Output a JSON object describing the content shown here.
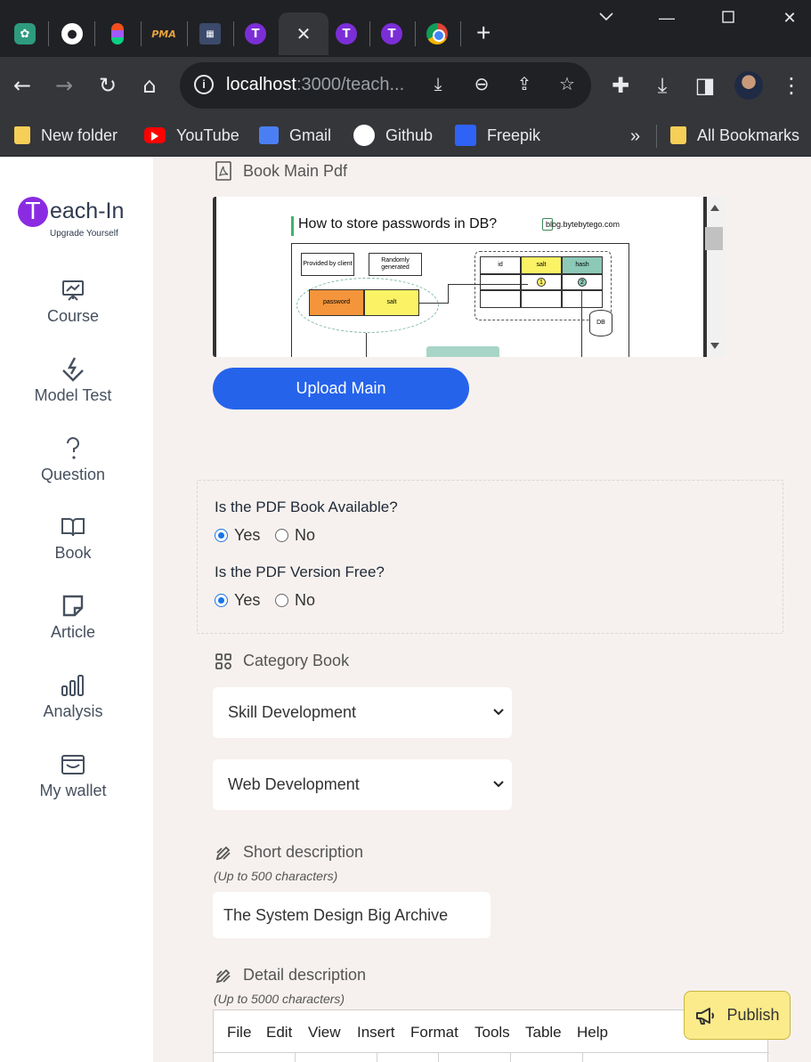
{
  "browser": {
    "tabs": [
      {
        "icon": "chatgpt-icon"
      },
      {
        "icon": "github-icon"
      },
      {
        "icon": "figma-icon"
      },
      {
        "icon": "pma-icon",
        "label": "PMA"
      },
      {
        "icon": "video-icon"
      },
      {
        "icon": "teach-in-icon",
        "label": "T"
      },
      {
        "icon": "close-icon",
        "label": "✕",
        "active": true
      },
      {
        "icon": "teach-in-icon",
        "label": "T"
      },
      {
        "icon": "teach-in-icon",
        "label": "T"
      },
      {
        "icon": "chrome-icon"
      }
    ],
    "url_host": "localhost",
    "url_rest": ":3000/teach...",
    "bookmarks": [
      "New folder",
      "YouTube",
      "Gmail",
      "Github",
      "Freepik"
    ],
    "bookmarks_more": "»",
    "all_bookmarks": "All Bookmarks"
  },
  "sidebar": {
    "logo_letter": "T",
    "logo_text": "each-In",
    "logo_tagline": "Upgrade Yourself",
    "items": [
      {
        "label": "Course",
        "icon": "presentation-icon"
      },
      {
        "label": "Model Test",
        "icon": "bolt-check-icon"
      },
      {
        "label": "Question",
        "icon": "question-icon"
      },
      {
        "label": "Book",
        "icon": "book-icon"
      },
      {
        "label": "Article",
        "icon": "note-icon"
      },
      {
        "label": "Analysis",
        "icon": "bar-chart-icon"
      },
      {
        "label": "My wallet",
        "icon": "wallet-icon"
      }
    ]
  },
  "main": {
    "book_pdf_title": "Book Main Pdf",
    "pdf_preview": {
      "heading": "How to store passwords in DB?",
      "source": "blog.bytebytego.com",
      "provided": "Provided by client",
      "random": "Randomly generated",
      "password": "password",
      "salt": "salt",
      "col_id": "id",
      "col_salt": "salt",
      "col_hash": "hash",
      "marker_1": "1",
      "marker_2": "2",
      "db": "DB"
    },
    "upload_button": "Upload Main",
    "pdf_available_question": "Is the PDF Book Available?",
    "pdf_free_question": "Is the PDF Version Free?",
    "yes": "Yes",
    "no": "No",
    "pdf_available": "Yes",
    "pdf_free": "Yes",
    "category_title": "Category Book",
    "category_primary": "Skill Development",
    "category_secondary": "Web Development",
    "short_desc_title": "Short description",
    "short_desc_hint": "(Up to 500 characters)",
    "short_desc_value": "The System Design Big Archive",
    "detail_desc_title": "Detail description",
    "detail_desc_hint": "(Up to 5000 characters)",
    "editor_menu": [
      "File",
      "Edit",
      "View",
      "Insert",
      "Format",
      "Tools",
      "Table",
      "Help"
    ],
    "publish_button": "Publish"
  },
  "colors": {
    "accent": "#2563eb",
    "brand": "#8a2be2",
    "page_bg": "#f6f1ee",
    "publish_bg": "#fbeb8a"
  }
}
